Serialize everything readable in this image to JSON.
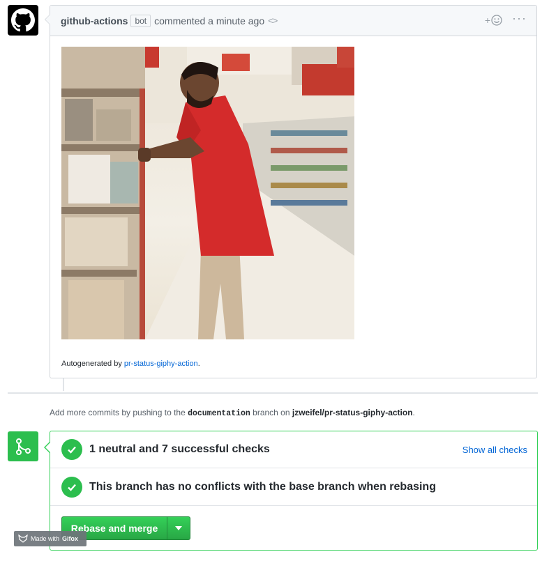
{
  "comment": {
    "author": "github-actions",
    "badge": "bot",
    "action": "commented a minute ago",
    "code_glyph": "<>",
    "react_glyph": "+",
    "more_glyph": "···",
    "footnote_prefix": "Autogenerated by ",
    "footnote_link": "pr-status-giphy-action",
    "footnote_suffix": "."
  },
  "push_note": {
    "prefix": "Add more commits by pushing to the ",
    "branch": "documentation",
    "middle": " branch on ",
    "repo": "jzweifel/pr-status-giphy-action",
    "suffix": "."
  },
  "merge": {
    "checks_summary": "1 neutral and 7 successful checks",
    "show_all_label": "Show all checks",
    "conflicts_status": "This branch has no conflicts with the base branch when rebasing",
    "merge_button_label": "Rebase and merge"
  },
  "watermark": {
    "prefix": "Made with ",
    "brand": "Gifox"
  },
  "icons": {
    "avatar": "github-octocat-icon",
    "merge": "git-branch-icon",
    "check": "check-icon"
  },
  "colors": {
    "success": "#2cbe4e",
    "link": "#0366d6",
    "border": "#d1d5da",
    "header_bg": "#f6f8fa"
  }
}
